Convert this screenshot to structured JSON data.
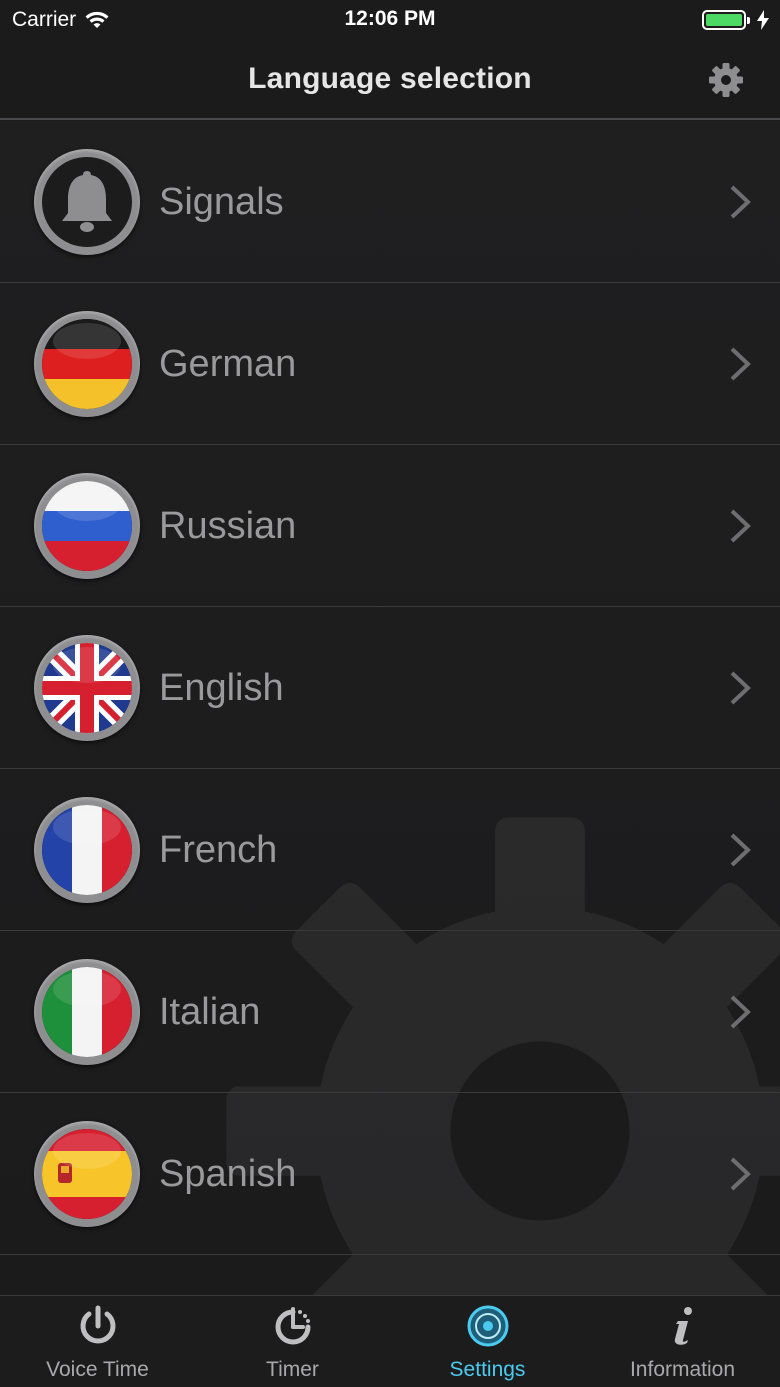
{
  "status_bar": {
    "carrier": "Carrier",
    "time": "12:06 PM",
    "battery_level": 1.0,
    "battery_color": "#4cd964"
  },
  "nav": {
    "title": "Language selection",
    "right_icon": "gear-icon"
  },
  "rows": [
    {
      "label": "Signals",
      "icon": "bell-icon"
    },
    {
      "label": "German",
      "icon": "flag-germany-icon"
    },
    {
      "label": "Russian",
      "icon": "flag-russia-icon"
    },
    {
      "label": "English",
      "icon": "flag-uk-icon"
    },
    {
      "label": "French",
      "icon": "flag-france-icon"
    },
    {
      "label": "Italian",
      "icon": "flag-italy-icon"
    },
    {
      "label": "Spanish",
      "icon": "flag-spain-icon"
    }
  ],
  "tabs": [
    {
      "label": "Voice Time",
      "icon": "power-icon",
      "active": false
    },
    {
      "label": "Timer",
      "icon": "timer-icon",
      "active": false
    },
    {
      "label": "Settings",
      "icon": "settings-ring-icon",
      "active": true
    },
    {
      "label": "Information",
      "icon": "info-icon",
      "active": false
    }
  ],
  "colors": {
    "accent": "#4ccbf0",
    "background": "#1b1b1c",
    "label": "#9a9a9c"
  }
}
